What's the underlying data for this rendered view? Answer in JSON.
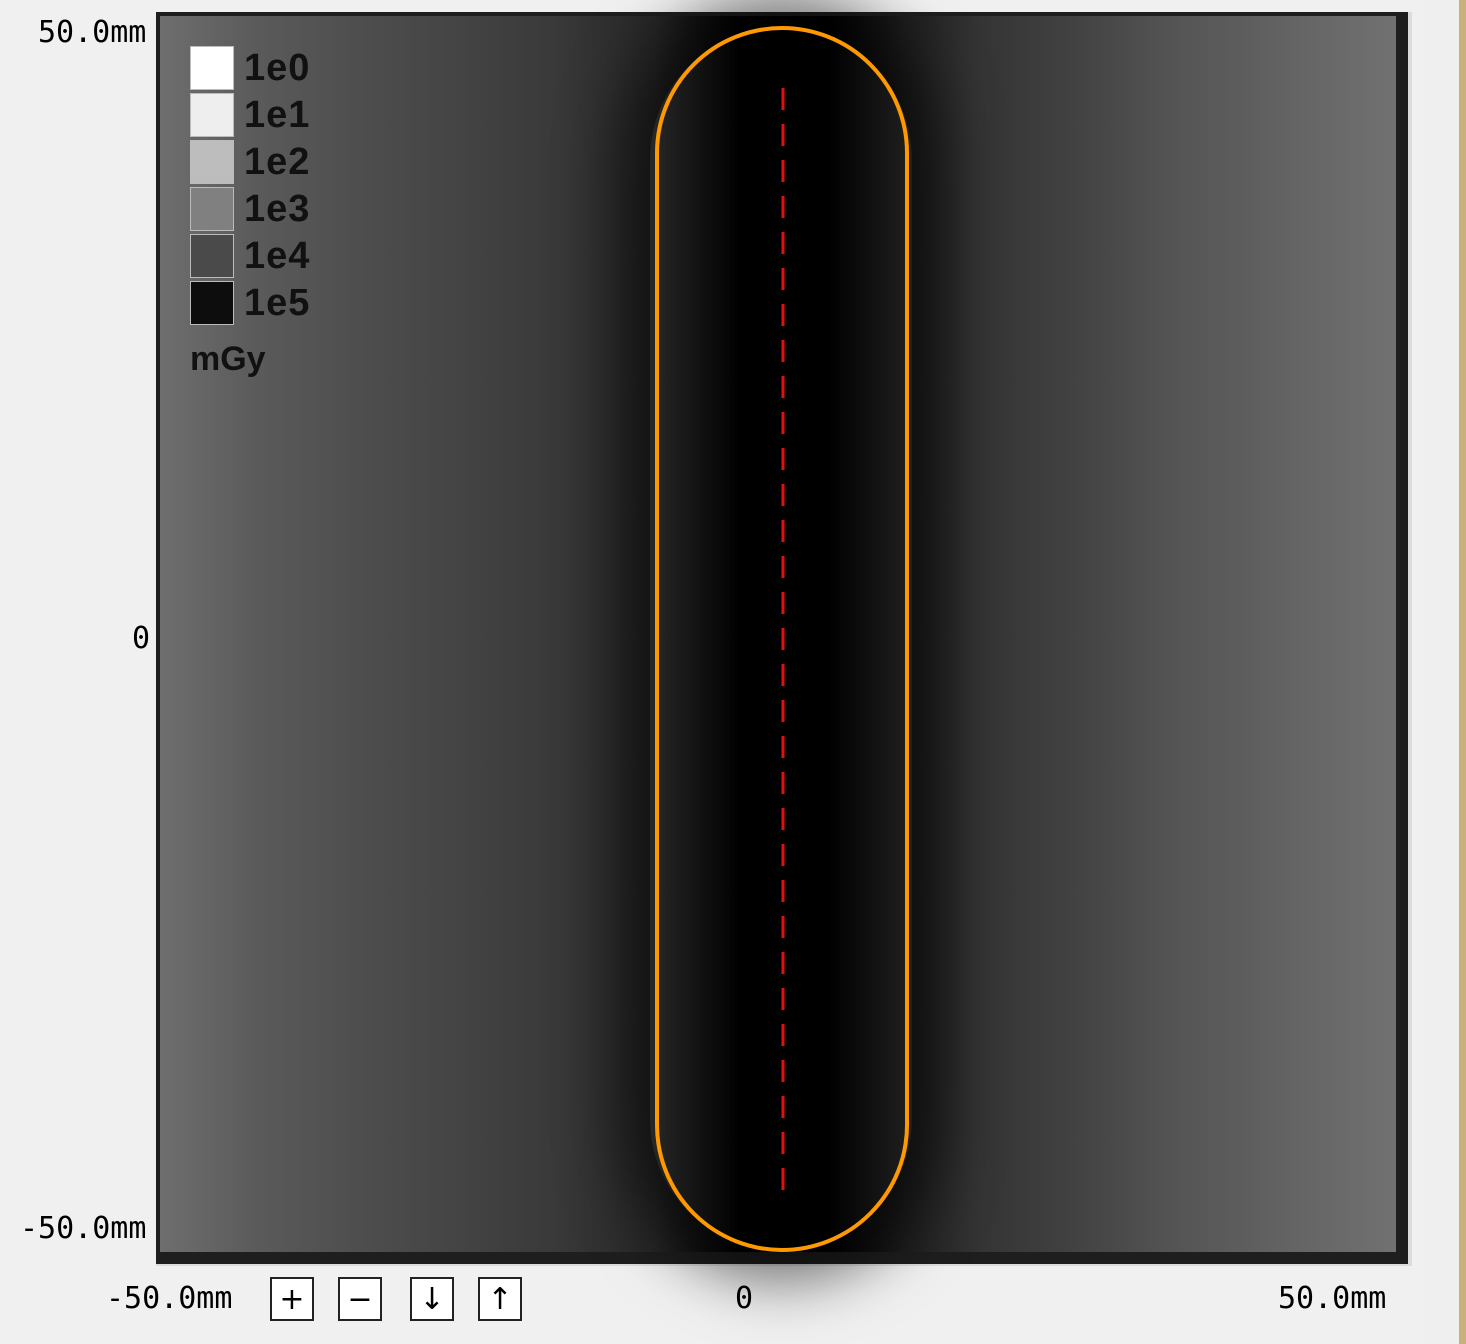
{
  "axis": {
    "y_top": "50.0mm",
    "y_mid": "0",
    "y_bottom": "-50.0mm",
    "x_left": "-50.0mm",
    "x_mid": "0",
    "x_right": "50.0mm"
  },
  "legend": {
    "items": [
      {
        "label": "1e0",
        "color": "#ffffff"
      },
      {
        "label": "1e1",
        "color": "#eeeeee"
      },
      {
        "label": "1e2",
        "color": "#bdbdbd"
      },
      {
        "label": "1e3",
        "color": "#808080"
      },
      {
        "label": "1e4",
        "color": "#4a4a4a"
      },
      {
        "label": "1e5",
        "color": "#0d0d0d"
      }
    ],
    "unit": "mGy"
  },
  "controls": {
    "zoom_in": "+",
    "zoom_out": "−",
    "down": "↓",
    "up": "↑"
  },
  "colors": {
    "contour": "#ff9900",
    "centerline": "#e01010"
  }
}
